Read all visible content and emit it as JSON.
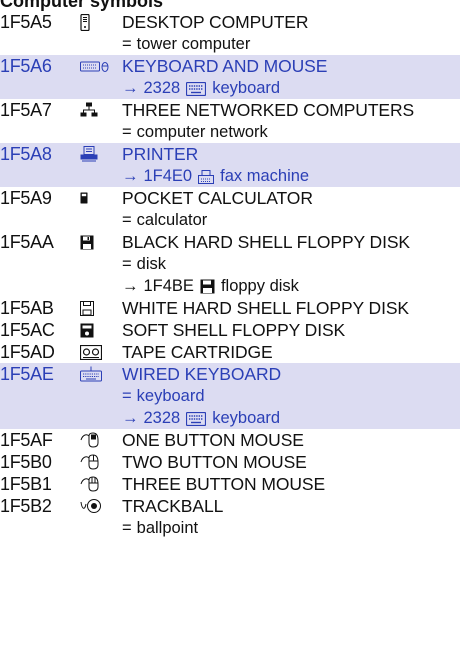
{
  "section_heading": "Computer symbols",
  "entries": [
    {
      "code": "1F5A5",
      "icon": "desktop-computer-icon",
      "name": "DESKTOP COMPUTER",
      "highlighted": false,
      "subs": [
        {
          "kind": "alias",
          "prefix": "=",
          "text": "tower computer"
        }
      ]
    },
    {
      "code": "1F5A6",
      "icon": "keyboard-and-mouse-icon",
      "name": "KEYBOARD AND MOUSE",
      "highlighted": true,
      "subs": [
        {
          "kind": "xref",
          "prefix": "→",
          "code": "2328",
          "icon": "keyboard-icon",
          "text": "keyboard"
        }
      ]
    },
    {
      "code": "1F5A7",
      "icon": "three-networked-computers-icon",
      "name": "THREE NETWORKED COMPUTERS",
      "highlighted": false,
      "subs": [
        {
          "kind": "alias",
          "prefix": "=",
          "text": "computer network"
        }
      ]
    },
    {
      "code": "1F5A8",
      "icon": "printer-icon",
      "name": "PRINTER",
      "highlighted": true,
      "subs": [
        {
          "kind": "xref",
          "prefix": "→",
          "code": "1F4E0",
          "icon": "fax-machine-icon",
          "text": "fax machine"
        }
      ]
    },
    {
      "code": "1F5A9",
      "icon": "pocket-calculator-icon",
      "name": "POCKET CALCULATOR",
      "highlighted": false,
      "subs": [
        {
          "kind": "alias",
          "prefix": "=",
          "text": "calculator"
        }
      ]
    },
    {
      "code": "1F5AA",
      "icon": "black-floppy-disk-icon",
      "name": "BLACK HARD SHELL FLOPPY DISK",
      "highlighted": false,
      "subs": [
        {
          "kind": "alias",
          "prefix": "=",
          "text": "disk"
        },
        {
          "kind": "xref",
          "prefix": "→",
          "code": "1F4BE",
          "icon": "floppy-disk-icon",
          "text": "floppy disk"
        }
      ]
    },
    {
      "code": "1F5AB",
      "icon": "white-floppy-disk-icon",
      "name": "WHITE HARD SHELL FLOPPY DISK",
      "highlighted": false,
      "subs": []
    },
    {
      "code": "1F5AC",
      "icon": "soft-floppy-disk-icon",
      "name": "SOFT SHELL FLOPPY DISK",
      "highlighted": false,
      "subs": []
    },
    {
      "code": "1F5AD",
      "icon": "tape-cartridge-icon",
      "name": "TAPE CARTRIDGE",
      "highlighted": false,
      "subs": []
    },
    {
      "code": "1F5AE",
      "icon": "wired-keyboard-icon",
      "name": "WIRED KEYBOARD",
      "highlighted": true,
      "subs": [
        {
          "kind": "alias",
          "prefix": "=",
          "text": "keyboard"
        },
        {
          "kind": "xref",
          "prefix": "→",
          "code": "2328",
          "icon": "keyboard-icon",
          "text": "keyboard"
        }
      ]
    },
    {
      "code": "1F5AF",
      "icon": "one-button-mouse-icon",
      "name": "ONE BUTTON MOUSE",
      "highlighted": false,
      "subs": []
    },
    {
      "code": "1F5B0",
      "icon": "two-button-mouse-icon",
      "name": "TWO BUTTON MOUSE",
      "highlighted": false,
      "subs": []
    },
    {
      "code": "1F5B1",
      "icon": "three-button-mouse-icon",
      "name": "THREE BUTTON MOUSE",
      "highlighted": false,
      "subs": []
    },
    {
      "code": "1F5B2",
      "icon": "trackball-icon",
      "name": "TRACKBALL",
      "highlighted": false,
      "subs": [
        {
          "kind": "alias",
          "prefix": "=",
          "text": "ballpoint"
        }
      ]
    }
  ],
  "colors": {
    "highlight_background": "#dcdcf2",
    "highlight_text": "#2b3fb6",
    "text": "#111111"
  }
}
